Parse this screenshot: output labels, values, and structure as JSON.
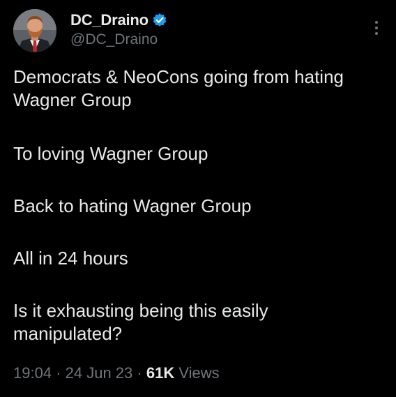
{
  "author": {
    "display_name": "DC_Draino",
    "handle": "@DC_Draino",
    "verified_icon": "verified-badge-icon",
    "verified_color": "#1d9bf0"
  },
  "tweet": {
    "paragraphs": [
      "Democrats & NeoCons going from hating Wagner Group",
      "To loving Wagner Group",
      "Back to hating Wagner Group",
      "All in 24 hours",
      "Is it exhausting being this easily manipulated?"
    ]
  },
  "meta": {
    "time": "19:04",
    "separator": "·",
    "date": "24 Jun 23",
    "views_count": "61K",
    "views_label": "Views"
  },
  "icons": {
    "more": "more-options-icon"
  },
  "colors": {
    "background": "#000000",
    "primary_text": "#e7e9ea",
    "secondary_text": "#71767b"
  }
}
